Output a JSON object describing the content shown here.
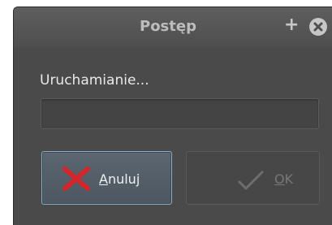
{
  "window": {
    "title": "Postęp"
  },
  "titlebar": {
    "plus_glyph": "+",
    "close_icon": "close-icon",
    "maximize_icon": "plus-icon"
  },
  "status": {
    "text": "Uruchamianie..."
  },
  "progress": {
    "value": 0
  },
  "buttons": {
    "cancel": {
      "mnemonic": "A",
      "rest": "nuluj",
      "icon": "cancel-x-icon"
    },
    "ok": {
      "mnemonic": "O",
      "rest": "K",
      "icon": "checkmark-icon",
      "enabled": false
    }
  },
  "colors": {
    "window_bg": "#4a4a4a",
    "cancel_x": "#d4262a",
    "focus_border": "#8fa9c2"
  }
}
